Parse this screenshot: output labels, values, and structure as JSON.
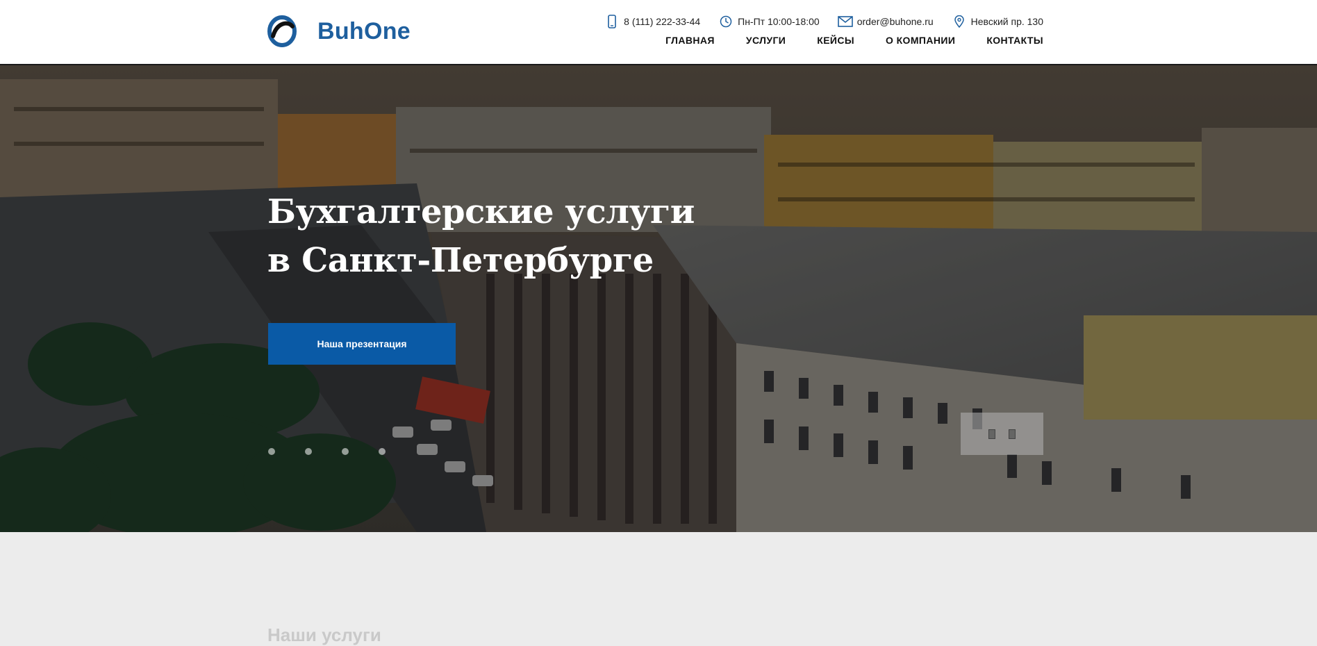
{
  "header": {
    "logo_text": "BuhOne",
    "contacts": {
      "phone": "8 (111) 222-33-44",
      "hours": "Пн-Пт 10:00-18:00",
      "email": "order@buhone.ru",
      "address": "Невский пр. 130"
    },
    "nav": [
      "ГЛАВНАЯ",
      "УСЛУГИ",
      "КЕЙСЫ",
      "О КОМПАНИИ",
      "КОНТАКТЫ"
    ]
  },
  "hero": {
    "title": "Бухгалтерские услуги\nв Санкт-Петербурге",
    "cta_label": "Наша презентация",
    "slide_count": 4
  },
  "services": {
    "title": "Наши услуги"
  },
  "colors": {
    "brand": "#1e5f9e",
    "cta": "#0a5aa6",
    "header_bg": "#ffffff",
    "section_bg": "#ececec"
  },
  "icons": [
    "phone-icon",
    "clock-icon",
    "mail-icon",
    "location-pin-icon"
  ]
}
